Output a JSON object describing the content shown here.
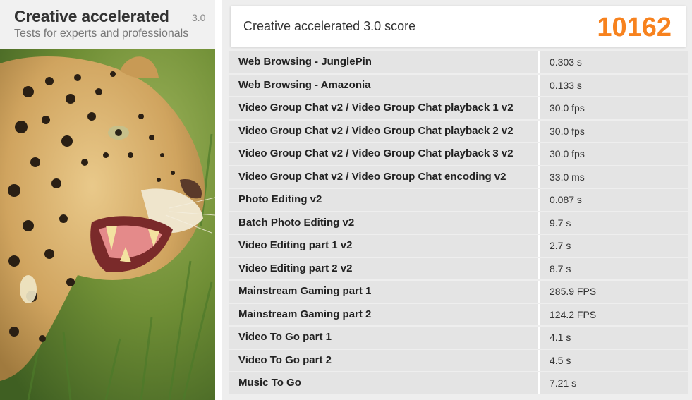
{
  "header": {
    "title": "Creative accelerated",
    "version": "3.0",
    "subtitle": "Tests for experts and professionals"
  },
  "image": {
    "subject": "leopard-photo"
  },
  "score": {
    "label": "Creative accelerated 3.0 score",
    "value": "10162",
    "color": "#f7821e"
  },
  "results": [
    {
      "name": "Web Browsing - JunglePin",
      "value": "0.303 s"
    },
    {
      "name": "Web Browsing - Amazonia",
      "value": "0.133 s"
    },
    {
      "name": "Video Group Chat v2 / Video Group Chat playback 1 v2",
      "value": "30.0 fps"
    },
    {
      "name": "Video Group Chat v2 / Video Group Chat playback 2 v2",
      "value": "30.0 fps"
    },
    {
      "name": "Video Group Chat v2 / Video Group Chat playback 3 v2",
      "value": "30.0 fps"
    },
    {
      "name": "Video Group Chat v2 / Video Group Chat encoding v2",
      "value": "33.0 ms"
    },
    {
      "name": "Photo Editing v2",
      "value": "0.087 s"
    },
    {
      "name": "Batch Photo Editing v2",
      "value": "9.7 s"
    },
    {
      "name": "Video Editing part 1 v2",
      "value": "2.7 s"
    },
    {
      "name": "Video Editing part 2 v2",
      "value": "8.7 s"
    },
    {
      "name": "Mainstream Gaming part 1",
      "value": "285.9 FPS"
    },
    {
      "name": "Mainstream Gaming part 2",
      "value": "124.2 FPS"
    },
    {
      "name": "Video To Go part 1",
      "value": "4.1 s"
    },
    {
      "name": "Video To Go part 2",
      "value": "4.5 s"
    },
    {
      "name": "Music To Go",
      "value": "7.21 s"
    }
  ]
}
